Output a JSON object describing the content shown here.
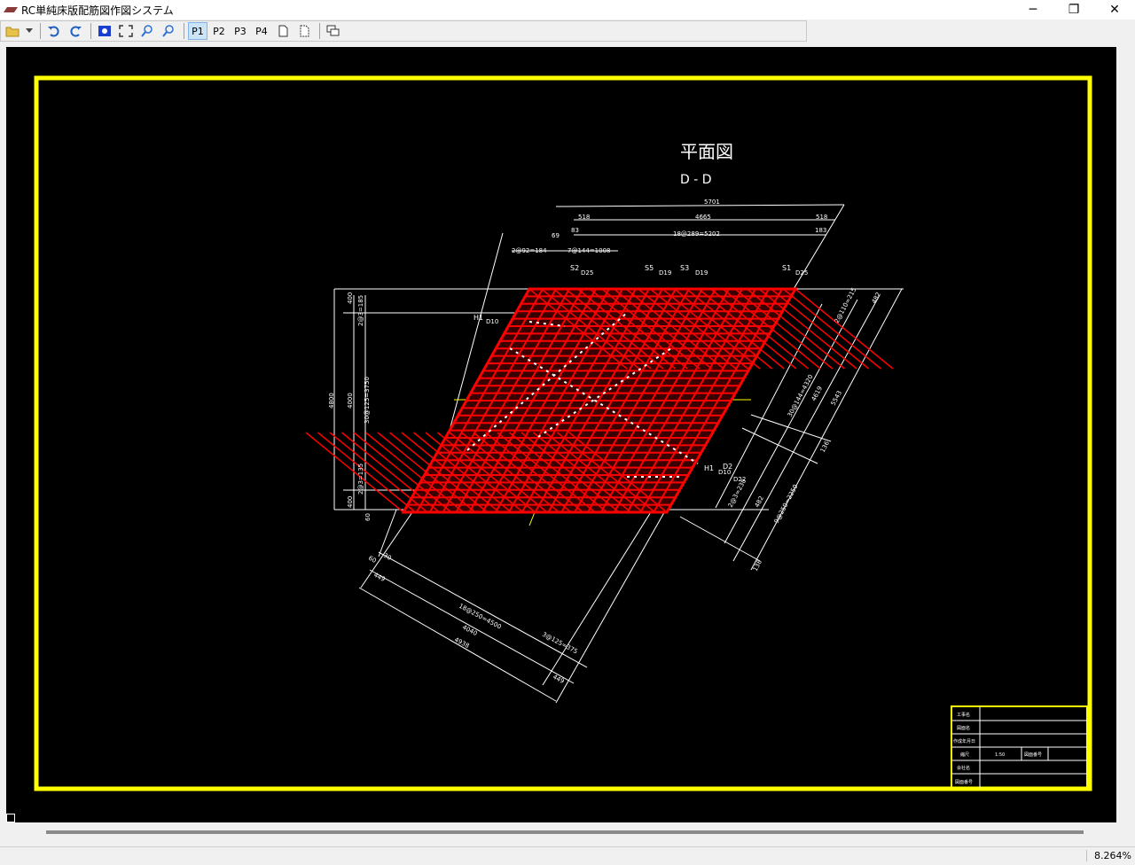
{
  "window": {
    "title": "RC単純床版配筋図作図システム",
    "minimize": "─",
    "maximize": "❐",
    "close": "✕"
  },
  "toolbar": {
    "pages": [
      "P1",
      "P2",
      "P3",
      "P4"
    ],
    "active_page": "P1"
  },
  "drawing": {
    "title": "平面図",
    "section": "D - D",
    "top_dims": [
      "5701",
      "518",
      "4665",
      "518",
      "69",
      "83",
      "18@289=5202",
      "183",
      "2@92=184",
      "7@144=1008"
    ],
    "rebar_labels": [
      "S2",
      "D25",
      "S5",
      "D19",
      "S3",
      "D19",
      "S1",
      "D25",
      "H1",
      "D10",
      "H1",
      "D10",
      "D2",
      "D22"
    ],
    "left_dims": [
      "400",
      "2@3=185",
      "4800",
      "4000",
      "30@125=3750",
      "2@3=135",
      "400",
      "60"
    ],
    "right_dims": [
      "2@110=215",
      "482",
      "30@144=4320",
      "4619",
      "5543",
      "136",
      "2@3=230",
      "482",
      "9@250=2250",
      "138"
    ],
    "bottom_dims": [
      "60",
      "30",
      "449",
      "18@250=4500",
      "4040",
      "4938",
      "3@125=375",
      "449"
    ]
  },
  "title_block": {
    "rows": [
      "工事名",
      "図面名",
      "作成年月日",
      "縮尺",
      "会社名",
      "図面番号"
    ],
    "scale": "1:50",
    "drawing_no_label": "図面番号"
  },
  "status": {
    "zoom": "8.264%"
  },
  "colors": {
    "frame": "#ffff00",
    "rebar": "#ff0000",
    "dims": "#ffffff",
    "background": "#000000"
  }
}
